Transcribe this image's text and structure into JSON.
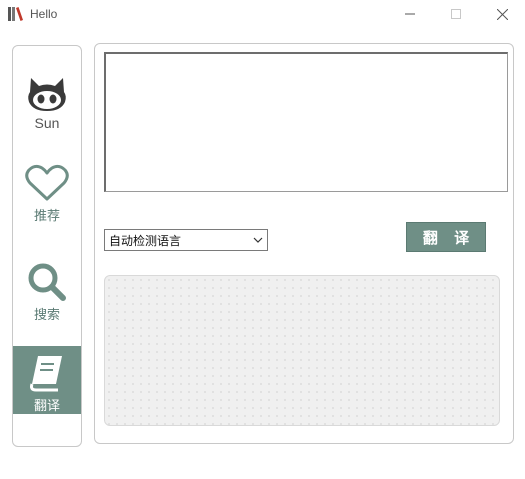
{
  "window": {
    "title": "Hello",
    "icon": "books-icon",
    "controls": [
      "minimize-icon",
      "maximize-icon",
      "close-icon"
    ]
  },
  "sidebar": {
    "items": [
      {
        "label": "Sun",
        "icon": "octocat-icon",
        "active": false
      },
      {
        "label": "推荐",
        "icon": "heart-icon",
        "active": false
      },
      {
        "label": "搜索",
        "icon": "search-icon",
        "active": false
      },
      {
        "label": "翻译",
        "icon": "book-icon",
        "active": true
      }
    ]
  },
  "translator": {
    "source_text": "",
    "language_select": {
      "selected": "自动检测语言"
    },
    "translate_label": "翻 译",
    "result_text": ""
  },
  "colors": {
    "accent": "#6f8f86",
    "nav_label": "#5a7a73",
    "result_bg": "#f0f0f0"
  }
}
